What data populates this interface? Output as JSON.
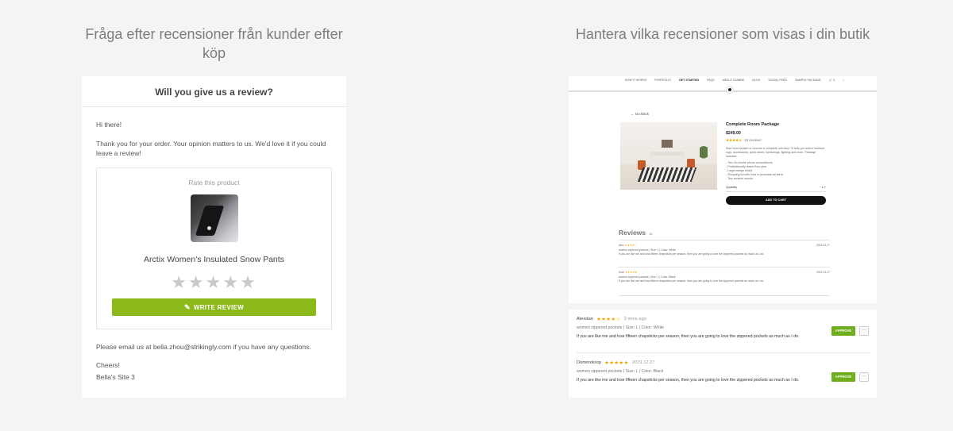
{
  "headings": {
    "left": "Fråga efter recensioner från kunder efter köp",
    "right": "Hantera vilka recensioner som visas i din butik"
  },
  "email": {
    "title": "Will you give us a review?",
    "greeting": "Hi there!",
    "intro": "Thank you for your order. Your opinion matters to us. We'd love it if you could leave a review!",
    "rate_label": "Rate this product",
    "product_name": "Arctix Women's Insulated Snow Pants",
    "stars": "★★★★★",
    "write_button": "WRITE REVIEW",
    "contact": "Please email us at bella.zhou@strikingly.com if you have any questions.",
    "signoff": "Cheers!",
    "site": "Bella's Site 3"
  },
  "store": {
    "nav": [
      "HOW IT WORKS",
      "PORTFOLIO",
      "GET STARTED",
      "FAQS",
      "ABOUT LEANNE",
      "BLOG",
      "SOCIAL FEED",
      "SAMPLE PACKAGE",
      "🛒 0",
      "⌕"
    ],
    "go_back": "← Go Back",
    "product_title": "Complete Room Package",
    "price": "$249.00",
    "product_stars": "★★★★☆",
    "review_count": "15 reviews",
    "description": "Start from scratch or execute a complete overhaul. I'll help you select furniture, rugs, accessories, paint colors, furnishings, lighting and more. Package includes:",
    "bullets": [
      "- Two 30-minute phone consultations",
      "- Professionally drawn floor plan",
      "- Large design board",
      "- Shopping list with links to purchase all items",
      "- Two revision rounds"
    ],
    "quantity_label": "Quantity",
    "quantity_value": "−   1   +",
    "add_to_cart": "ADD TO CART",
    "reviews_heading": "Reviews",
    "reviews_count": "15",
    "mini_reviews": [
      {
        "name": "Alex",
        "stars": "★★★★☆",
        "date": "2019.12.27",
        "variant": "women zippered pockets  |  Size: L  |  Color: White",
        "text": "If you are like me and lose fifteen chapsticks per season, then you are going to love the zippered pockets as much as I do."
      },
      {
        "name": "Dom",
        "stars": "★★★★★",
        "date": "2019.12.27",
        "variant": "women zippered pockets  |  Size: L  |  Color: Black",
        "text": "If you are like me and lose fifteen chapsticks per season, then you are going to love the zippered pockets as much as I do."
      }
    ]
  },
  "admin": {
    "reviews": [
      {
        "name": "Alexdan",
        "stars": "★★★★☆",
        "date": "2 mins ago",
        "variant": "women zippered pockets  |  Size: L  |  Color: White",
        "text": "If you are like me and lose fifteen chapsticks per season, then you are going to love the zippered pockets as much as I do.",
        "approve": "APPROVE",
        "more": "···"
      },
      {
        "name": "Dominoloop",
        "stars": "★★★★★",
        "date": "2019.12.27",
        "variant": "women zippered pockets  |  Size: L  |  Color: Black",
        "text": "If you are like me and lose fifteen chapsticks per season, then you are going to love the zippered pockets as much as I do.",
        "approve": "APPROVE",
        "more": "···"
      }
    ]
  },
  "colors": {
    "background": "#f4f4f4",
    "write_review_green": "#8ab919",
    "approve_green": "#6fae1c",
    "star_gold": "#f0a500",
    "star_empty": "#c9c9c9"
  }
}
